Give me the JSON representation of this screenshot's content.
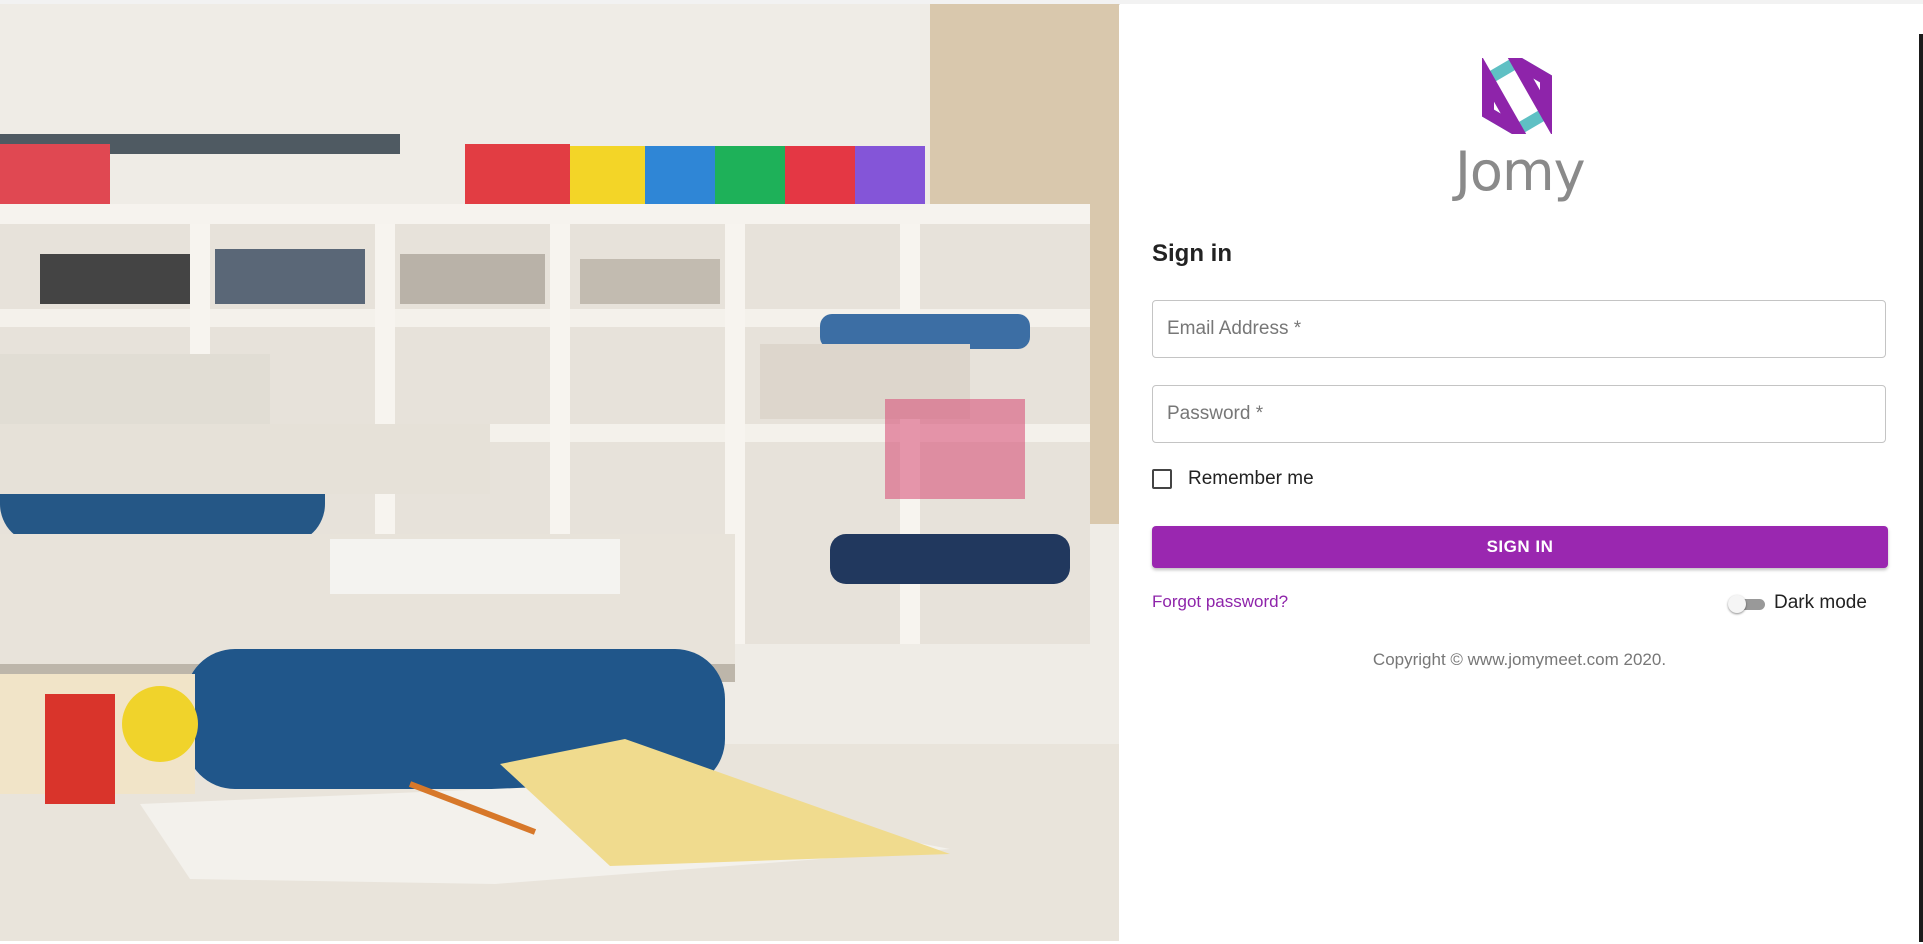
{
  "brand": {
    "name": "Jomy",
    "logo_icon": "hexagon-logo-icon",
    "colors": {
      "teal": "#5fc0c4",
      "purple": "#8e24aa"
    }
  },
  "background_image": {
    "description": ""
  },
  "signin": {
    "heading": "Sign in",
    "email_placeholder": "Email Address *",
    "password_placeholder": "Password *",
    "remember_label": "Remember me",
    "button_label": "SIGN IN",
    "forgot_link": "Forgot password?",
    "dark_mode_label": "Dark mode",
    "dark_mode_enabled": false,
    "remember_checked": false,
    "copyright": "Copyright © www.jomymeet.com 2020."
  },
  "theme": {
    "primary_button": "#9c27b0",
    "link_color": "#8e24aa"
  }
}
